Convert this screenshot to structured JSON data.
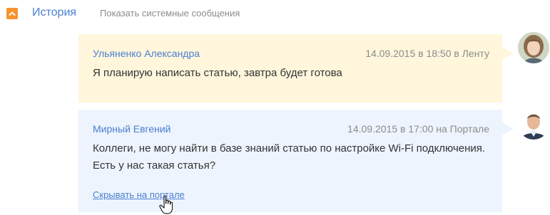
{
  "header": {
    "collapse_icon": "chevron-up-icon",
    "title": "История",
    "system_messages_link": "Показать системные сообщения"
  },
  "messages": [
    {
      "author": "Ульяненко Александра",
      "meta": "14.09.2015 в 18:50 в Ленту",
      "text": "Я планирую написать статью, завтра будет готова",
      "background": "#fff6dc"
    },
    {
      "author": "Мирный Евгений",
      "meta": "14.09.2015 в 17:00 на Портале",
      "text": "Коллеги, не могу найти в базе знаний статью по настройке Wi-Fi подключения. Есть у нас такая статья?",
      "action": "Скрывать на портале",
      "background": "#edf4fd"
    }
  ],
  "colors": {
    "accent": "#4b7ed1",
    "orange": "#f7922e",
    "muted": "#8c8c8c"
  }
}
